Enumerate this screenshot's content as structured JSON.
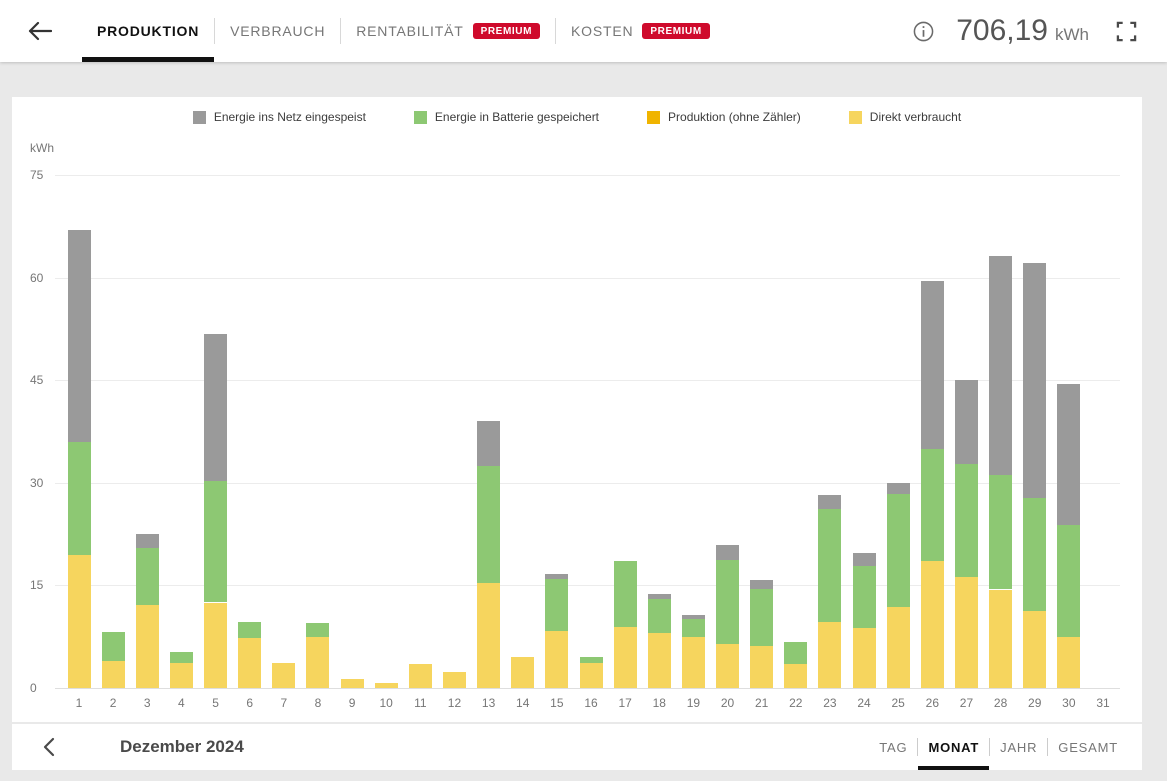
{
  "header": {
    "back_icon": "arrow-left",
    "tabs": [
      {
        "label": "PRODUKTION",
        "active": true,
        "premium": false
      },
      {
        "label": "VERBRAUCH",
        "active": false,
        "premium": false
      },
      {
        "label": "RENTABILITÄT",
        "active": false,
        "premium": true
      },
      {
        "label": "KOSTEN",
        "active": false,
        "premium": true
      }
    ],
    "premium_badge_label": "PREMIUM",
    "info_icon": "info-circle",
    "total_value": "706,19",
    "total_unit": "kWh",
    "fullscreen_icon": "fullscreen-corners"
  },
  "chart_data": {
    "type": "bar",
    "stacked": true,
    "unit_label": "kWh",
    "ylim": [
      0,
      75
    ],
    "y_ticks": [
      0,
      15,
      30,
      45,
      60,
      75
    ],
    "grid": true,
    "legend_position": "top",
    "categories": [
      1,
      2,
      3,
      4,
      5,
      6,
      7,
      8,
      9,
      10,
      11,
      12,
      13,
      14,
      15,
      16,
      17,
      18,
      19,
      20,
      21,
      22,
      23,
      24,
      25,
      26,
      27,
      28,
      29,
      30,
      31
    ],
    "series": [
      {
        "name": "Energie ins Netz eingespeist",
        "color": "#9a9a9a",
        "values": [
          31,
          0,
          2,
          0,
          21.5,
          0,
          0,
          0,
          0,
          0,
          0,
          0,
          6.6,
          0,
          0.7,
          0,
          0,
          0.7,
          0.6,
          2.2,
          1.3,
          0,
          2,
          2,
          1.6,
          24.5,
          12.4,
          31.9,
          34.3,
          20.6,
          0
        ]
      },
      {
        "name": "Energie in Batterie gespeichert",
        "color": "#8dc873",
        "values": [
          16.5,
          4.2,
          8.3,
          1.7,
          17.8,
          2.4,
          0,
          2,
          0,
          0,
          0,
          0,
          17.2,
          0,
          7.6,
          1,
          9.6,
          5,
          2.7,
          12.3,
          8.3,
          3.2,
          16.6,
          9,
          16.5,
          16.4,
          16.5,
          16.8,
          16.5,
          16.4,
          0
        ]
      },
      {
        "name": "Produktion (ohne Zähler)",
        "color": "#f0b400",
        "values": [
          0,
          0,
          0,
          0,
          0,
          0,
          0,
          0,
          0,
          0,
          0,
          0,
          0,
          0,
          0,
          0,
          0,
          0,
          0,
          0,
          0,
          0,
          0,
          0,
          0,
          0,
          0,
          0,
          0,
          0,
          0
        ]
      },
      {
        "name": "Direkt verbraucht",
        "color": "#f6d55e",
        "values": [
          19.5,
          4,
          12.2,
          3.6,
          12.5,
          7.3,
          3.7,
          7.5,
          1.3,
          0.8,
          3.5,
          2.3,
          15.3,
          4.6,
          8.4,
          3.6,
          8.9,
          8,
          7.4,
          6.4,
          6.2,
          3.5,
          9.6,
          8.8,
          11.8,
          18.6,
          16.2,
          14.4,
          11.3,
          7.5,
          0
        ]
      }
    ]
  },
  "toolbar": {
    "back_icon": "chevron-left",
    "period_label": "Dezember 2024",
    "views": [
      {
        "label": "TAG",
        "active": false
      },
      {
        "label": "MONAT",
        "active": true
      },
      {
        "label": "JAHR",
        "active": false
      },
      {
        "label": "GESAMT",
        "active": false
      }
    ]
  }
}
